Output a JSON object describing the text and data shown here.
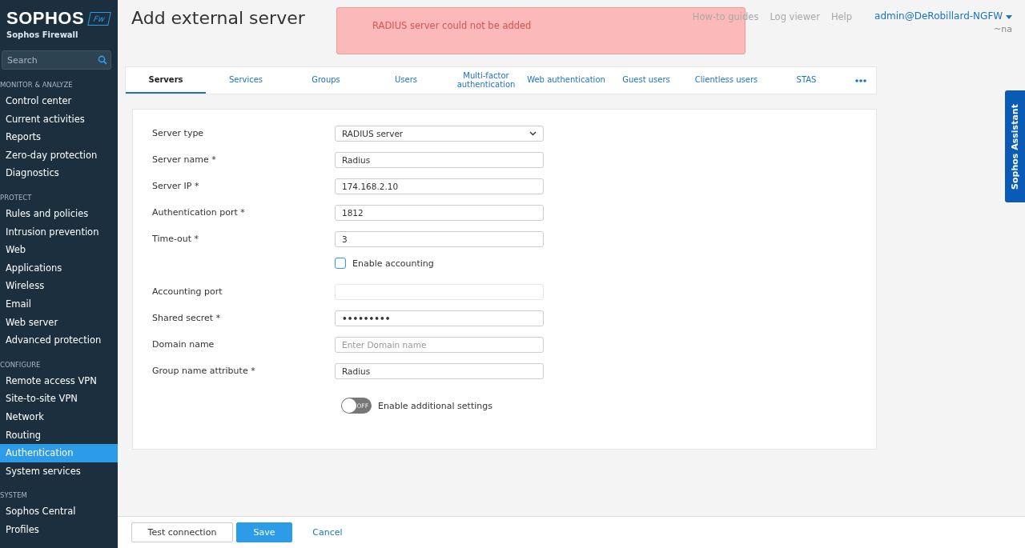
{
  "brand": {
    "logo": "SOPHOS",
    "badge": "Fw",
    "product": "Sophos Firewall"
  },
  "search": {
    "placeholder": "Search"
  },
  "sidebar": {
    "sections": [
      {
        "title": "MONITOR & ANALYZE",
        "items": [
          {
            "label": "Control center",
            "selected": false
          },
          {
            "label": "Current activities",
            "selected": false
          },
          {
            "label": "Reports",
            "selected": false
          },
          {
            "label": "Zero-day protection",
            "selected": false
          },
          {
            "label": "Diagnostics",
            "selected": false
          }
        ]
      },
      {
        "title": "PROTECT",
        "items": [
          {
            "label": "Rules and policies",
            "selected": false
          },
          {
            "label": "Intrusion prevention",
            "selected": false
          },
          {
            "label": "Web",
            "selected": false
          },
          {
            "label": "Applications",
            "selected": false
          },
          {
            "label": "Wireless",
            "selected": false
          },
          {
            "label": "Email",
            "selected": false
          },
          {
            "label": "Web server",
            "selected": false
          },
          {
            "label": "Advanced protection",
            "selected": false
          }
        ]
      },
      {
        "title": "CONFIGURE",
        "items": [
          {
            "label": "Remote access VPN",
            "selected": false
          },
          {
            "label": "Site-to-site VPN",
            "selected": false
          },
          {
            "label": "Network",
            "selected": false
          },
          {
            "label": "Routing",
            "selected": false
          },
          {
            "label": "Authentication",
            "selected": true
          },
          {
            "label": "System services",
            "selected": false
          }
        ]
      },
      {
        "title": "SYSTEM",
        "items": [
          {
            "label": "Sophos Central",
            "selected": false
          },
          {
            "label": "Profiles",
            "selected": false
          }
        ]
      }
    ]
  },
  "page_title": "Add external server",
  "alert": {
    "message": "RADIUS server could not be added"
  },
  "header_links": [
    "How-to guides",
    "Log viewer",
    "Help"
  ],
  "user": {
    "name": "admin@DeRobillard-NGFW",
    "sub": "~na"
  },
  "tabs": [
    {
      "label": "Servers",
      "selected": true
    },
    {
      "label": "Services",
      "selected": false
    },
    {
      "label": "Groups",
      "selected": false
    },
    {
      "label": "Users",
      "selected": false
    },
    {
      "label": "Multi-factor authentication",
      "selected": false
    },
    {
      "label": "Web authentication",
      "selected": false
    },
    {
      "label": "Guest users",
      "selected": false
    },
    {
      "label": "Clientless users",
      "selected": false
    },
    {
      "label": "STAS",
      "selected": false
    }
  ],
  "form": [
    {
      "kind": "select",
      "label": "Server type",
      "value": "RADIUS server"
    },
    {
      "kind": "text",
      "label": "Server name *",
      "value": "Radius"
    },
    {
      "kind": "text",
      "label": "Server IP *",
      "value": "174.168.2.10"
    },
    {
      "kind": "text",
      "label": "Authentication port *",
      "value": "1812"
    },
    {
      "kind": "text",
      "label": "Time-out *",
      "value": "3"
    },
    {
      "kind": "checkbox",
      "label": "Enable accounting",
      "checked": false
    },
    {
      "kind": "text",
      "label": "Accounting port",
      "disabled": true
    },
    {
      "kind": "password",
      "label": "Shared secret *",
      "value": "•••••••••"
    },
    {
      "kind": "text",
      "label": "Domain name",
      "placeholder": "Enter Domain name"
    },
    {
      "kind": "text",
      "label": "Group name attribute *",
      "value": "Radius"
    },
    {
      "kind": "toggle",
      "label": "Enable additional settings",
      "on": false,
      "state_text": "OFF"
    }
  ],
  "buttons": [
    {
      "kind": "secondary",
      "label": "Test connection"
    },
    {
      "kind": "primary",
      "label": "Save"
    },
    {
      "kind": "link",
      "label": "Cancel"
    }
  ],
  "assistant": {
    "label": "Sophos Assistant"
  }
}
